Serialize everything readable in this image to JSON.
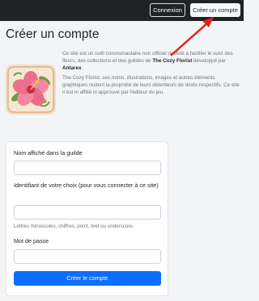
{
  "topbar": {
    "login_label": "Connexion",
    "signup_label": "Créer un compte"
  },
  "page": {
    "title": "Créer un compte"
  },
  "intro": {
    "p1_a": "Ce site est un outil communautaire non officiel destiné à faciliter le suivi des fleurs, des collections et des guildes de ",
    "p1_game": "The Cozy Florist",
    "p1_b": " développé par ",
    "p1_dev": "Antarex",
    "p1_c": ".",
    "p2": "The Cozy Florist, ses noms, illustrations, images et autres éléments graphiques restent la propriété de leurs détenteurs de droits respectifs. Ce site n'est ni affilié ni approuvé par l'éditeur du jeu."
  },
  "form": {
    "display_name_label": "Nom affiché dans la guilde",
    "display_name_value": "",
    "identifier_label": "Identifiant de votre choix (pour vous connecter à ce site)",
    "identifier_value": "",
    "identifier_help": "Lettres minuscules, chiffres, point, tiret ou underscore.",
    "password_label": "Mot de passe",
    "password_value": "",
    "submit_label": "Créer le compte"
  },
  "colors": {
    "topbar": "#1f2326",
    "primary": "#0d6efd",
    "arrow": "#e0251b",
    "muted": "#6c757d"
  },
  "icons": {
    "logo": "hibiscus-flower-icon",
    "annotation": "red-arrow-icon"
  }
}
